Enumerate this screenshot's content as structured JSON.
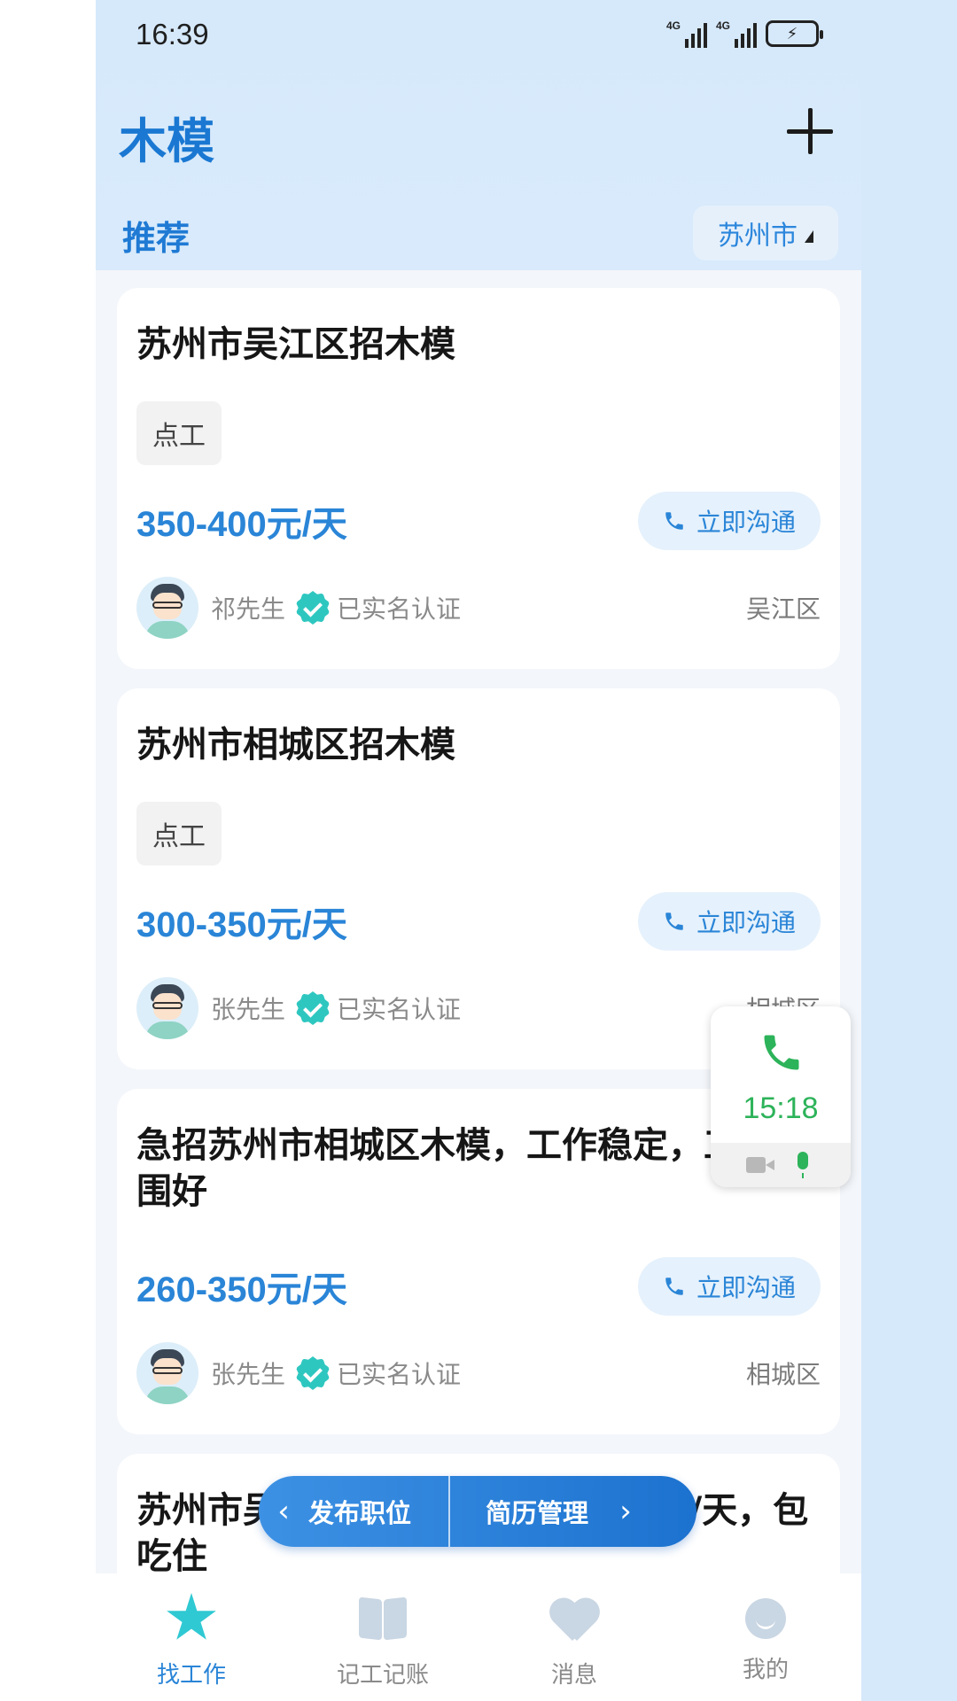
{
  "status_bar": {
    "time": "16:39",
    "signal1_label": "4G",
    "signal2_label": "4G",
    "battery_icon": "battery-charging-icon"
  },
  "header": {
    "title": "木模",
    "add_icon": "plus-icon"
  },
  "section": {
    "label": "推荐",
    "city": "苏州市"
  },
  "jobs": [
    {
      "title": "苏州市吴江区招木模",
      "tag": "点工",
      "price": "350-400元/天",
      "chat_label": "立即沟通",
      "owner": "祁先生",
      "verified": "已实名认证",
      "district": "吴江区"
    },
    {
      "title": "苏州市相城区招木模",
      "tag": "点工",
      "price": "300-350元/天",
      "chat_label": "立即沟通",
      "owner": "张先生",
      "verified": "已实名认证",
      "district": "相城区"
    },
    {
      "title": "急招苏州市相城区木模，工作稳定，工作氛围好",
      "price": "260-350元/天",
      "chat_label": "立即沟通",
      "owner": "张先生",
      "verified": "已实名认证",
      "district": "相城区"
    },
    {
      "title": "苏州市吴江区招木模，300-350元/天，包吃住"
    }
  ],
  "call_widget": {
    "duration": "15:18",
    "accent": "#2db35a"
  },
  "action_bar": {
    "post_job": "发布职位",
    "resume_manage": "简历管理",
    "prev": "‹",
    "next": "›"
  },
  "bottom_nav": {
    "items": [
      {
        "label": "找工作",
        "icon": "star-icon",
        "active": true
      },
      {
        "label": "记工记账",
        "icon": "book-icon"
      },
      {
        "label": "消息",
        "icon": "heart-chat-icon"
      },
      {
        "label": "我的",
        "icon": "person-icon"
      }
    ]
  },
  "colors": {
    "accent": "#2a85d7",
    "header_bg": "#d6e9fb",
    "verify": "#2ec7c0"
  }
}
